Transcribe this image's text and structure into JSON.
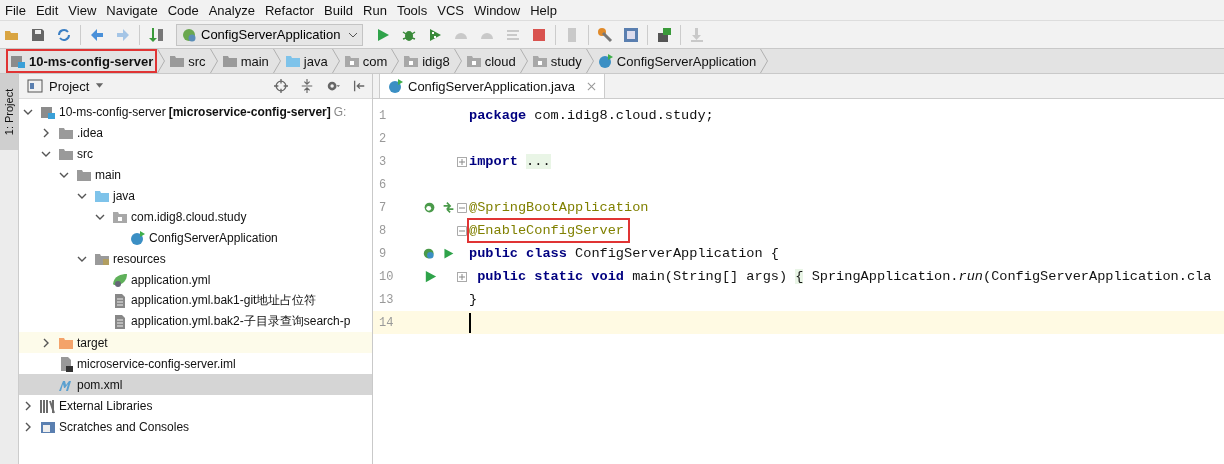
{
  "menu": [
    "File",
    "Edit",
    "View",
    "Navigate",
    "Code",
    "Analyze",
    "Refactor",
    "Build",
    "Run",
    "Tools",
    "VCS",
    "Window",
    "Help"
  ],
  "toolbar": [
    {
      "kind": "open",
      "disabled": false
    },
    {
      "kind": "save",
      "disabled": false
    },
    {
      "kind": "sync",
      "disabled": false
    },
    {
      "kind": "sep"
    },
    {
      "kind": "back",
      "disabled": false
    },
    {
      "kind": "forward",
      "disabled": true
    },
    {
      "kind": "sep"
    },
    {
      "kind": "build",
      "disabled": false
    },
    {
      "kind": "config",
      "label": "ConfigServerApplication"
    },
    {
      "kind": "run",
      "disabled": false
    },
    {
      "kind": "debug",
      "disabled": false
    },
    {
      "kind": "coverage",
      "disabled": false
    },
    {
      "kind": "profile",
      "disabled": true
    },
    {
      "kind": "profile",
      "disabled": true
    },
    {
      "kind": "lines",
      "disabled": true
    },
    {
      "kind": "stop",
      "disabled": false
    },
    {
      "kind": "sep"
    },
    {
      "kind": "device",
      "disabled": true
    },
    {
      "kind": "sep"
    },
    {
      "kind": "wrench",
      "disabled": false
    },
    {
      "kind": "structure",
      "disabled": false
    },
    {
      "kind": "sep"
    },
    {
      "kind": "sdk",
      "disabled": false
    },
    {
      "kind": "sep"
    },
    {
      "kind": "download",
      "disabled": true
    }
  ],
  "breadcrumb": [
    {
      "label": "10-ms-config-server",
      "kind": "module",
      "highlighted": true
    },
    {
      "label": "src",
      "kind": "folder",
      "highlighted": false
    },
    {
      "label": "main",
      "kind": "folder",
      "highlighted": false
    },
    {
      "label": "java",
      "kind": "source",
      "highlighted": false
    },
    {
      "label": "com",
      "kind": "package",
      "highlighted": false
    },
    {
      "label": "idig8",
      "kind": "package",
      "highlighted": false
    },
    {
      "label": "cloud",
      "kind": "package",
      "highlighted": false
    },
    {
      "label": "study",
      "kind": "package",
      "highlighted": false
    },
    {
      "label": "ConfigServerApplication",
      "kind": "spring-class",
      "highlighted": false
    }
  ],
  "side_tab": {
    "label": "1: Project",
    "selected": true
  },
  "project": {
    "title": "Project",
    "tree": [
      {
        "name": "10-ms-config-server",
        "module": "[microservice-config-server]",
        "path": "G:",
        "kind": "module",
        "expanded": true,
        "selected": false,
        "excluded": false,
        "children": [
          {
            "name": ".idea",
            "kind": "folder",
            "expanded": false,
            "selected": false,
            "excluded": false
          },
          {
            "name": "src",
            "kind": "folder",
            "expanded": true,
            "selected": false,
            "excluded": false,
            "children": [
              {
                "name": "main",
                "kind": "folder",
                "expanded": true,
                "selected": false,
                "excluded": false,
                "children": [
                  {
                    "name": "java",
                    "kind": "source",
                    "expanded": true,
                    "selected": false,
                    "excluded": false,
                    "children": [
                      {
                        "name": "com.idig8.cloud.study",
                        "kind": "package",
                        "expanded": true,
                        "selected": false,
                        "excluded": false,
                        "children": [
                          {
                            "name": "ConfigServerApplication",
                            "kind": "spring-class",
                            "selected": false,
                            "excluded": false
                          }
                        ]
                      }
                    ]
                  },
                  {
                    "name": "resources",
                    "kind": "resources",
                    "expanded": true,
                    "selected": false,
                    "excluded": false,
                    "children": [
                      {
                        "name": "application.yml",
                        "kind": "spring-yml",
                        "selected": false,
                        "excluded": false
                      },
                      {
                        "name": "application.yml.bak1-git地址占位符",
                        "kind": "text-file",
                        "selected": false,
                        "excluded": false
                      },
                      {
                        "name": "application.yml.bak2-子目录查询search-p",
                        "kind": "text-file",
                        "selected": false,
                        "excluded": false
                      }
                    ]
                  }
                ]
              }
            ]
          },
          {
            "name": "target",
            "kind": "excluded-folder",
            "expanded": false,
            "selected": false,
            "excluded": true
          },
          {
            "name": "microservice-config-server.iml",
            "kind": "iml",
            "selected": false,
            "excluded": false
          },
          {
            "name": "pom.xml",
            "kind": "maven",
            "selected": true,
            "excluded": false
          }
        ]
      },
      {
        "name": "External Libraries",
        "kind": "libraries",
        "expanded": false,
        "selected": false,
        "excluded": false
      },
      {
        "name": "Scratches and Consoles",
        "kind": "scratches",
        "expanded": false,
        "selected": false,
        "excluded": false
      }
    ]
  },
  "editor": {
    "tab": {
      "label": "ConfigServerApplication.java",
      "selected": true
    },
    "lines": [
      {
        "number": "1",
        "highlighted": false,
        "current": false,
        "tokens": [
          {
            "kind": "keyword",
            "text": "package"
          },
          {
            "kind": "plain",
            "text": " com.idig8.cloud.study;"
          }
        ]
      },
      {
        "number": "2",
        "highlighted": false,
        "current": false
      },
      {
        "number": "3",
        "highlighted": false,
        "current": false,
        "tokens": [
          {
            "kind": "keyword",
            "text": "import "
          },
          {
            "kind": "folded",
            "text": "..."
          }
        ]
      },
      {
        "number": "6",
        "highlighted": false,
        "current": false
      },
      {
        "number": "7",
        "highlighted": false,
        "current": false,
        "tokens": [
          {
            "kind": "annotation",
            "text": "@SpringBootApplication"
          }
        ]
      },
      {
        "number": "8",
        "highlighted": true,
        "current": false,
        "tokens": [
          {
            "kind": "annotation",
            "text": "@EnableConfigServer"
          }
        ]
      },
      {
        "number": "9",
        "highlighted": false,
        "current": false,
        "tokens": [
          {
            "kind": "keyword",
            "text": "public class"
          },
          {
            "kind": "plain",
            "text": " ConfigServerApplication {"
          }
        ]
      },
      {
        "number": "10",
        "highlighted": false,
        "current": false,
        "tokens": [
          {
            "kind": "keyword",
            "text": " public static void"
          },
          {
            "kind": "plain",
            "text": " main(String[] args) "
          },
          {
            "kind": "folded",
            "text": "{"
          },
          {
            "kind": "plain",
            "text": " SpringApplication."
          },
          {
            "kind": "method",
            "text": "run"
          },
          {
            "kind": "plain",
            "text": "(ConfigServerApplication.cla"
          }
        ]
      },
      {
        "number": "13",
        "highlighted": false,
        "current": false,
        "tokens": [
          {
            "kind": "plain",
            "text": "}"
          }
        ]
      },
      {
        "number": "14",
        "highlighted": false,
        "current": true
      }
    ]
  }
}
